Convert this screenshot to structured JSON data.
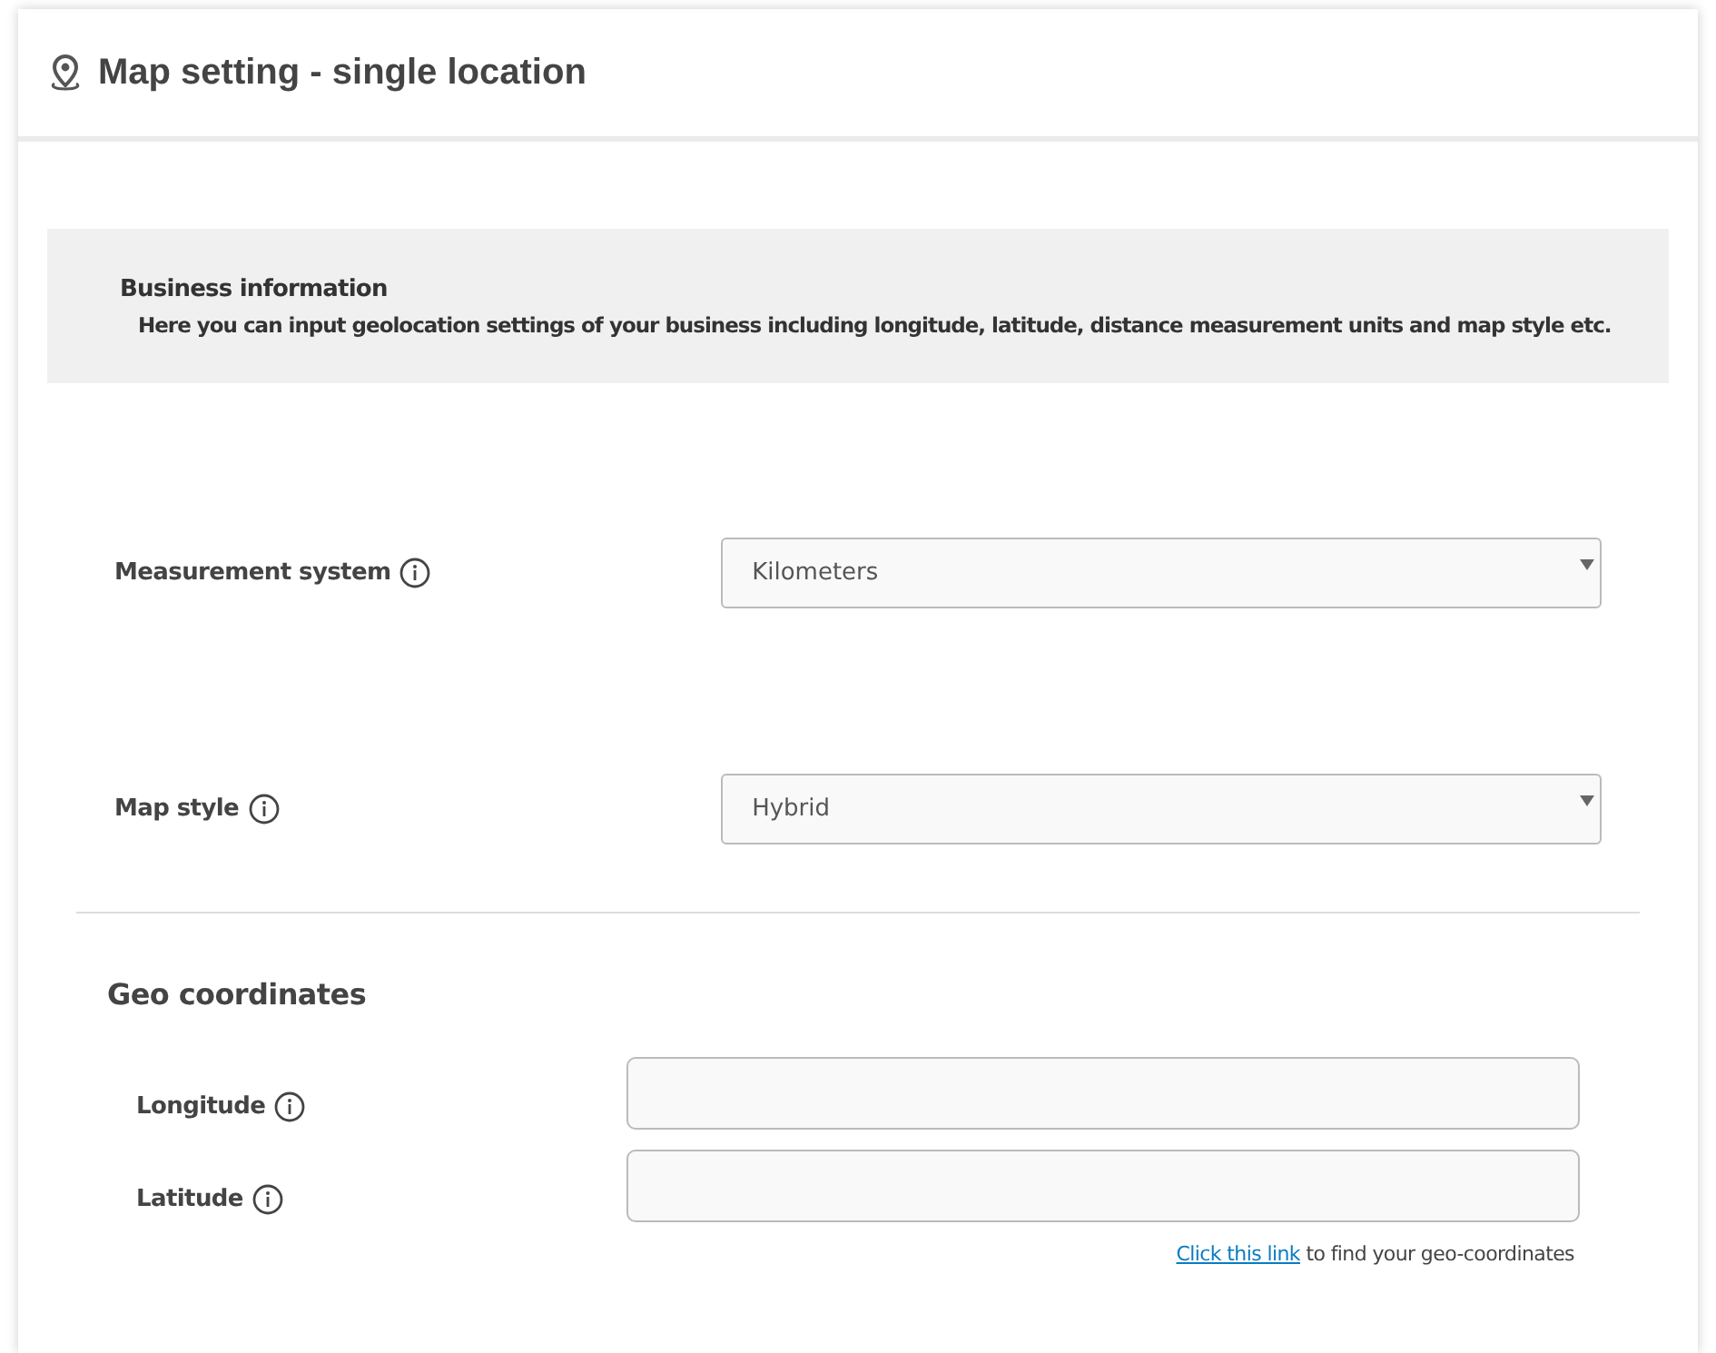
{
  "header": {
    "title": "Map setting - single location"
  },
  "info": {
    "title": "Business information",
    "text": "Here you can input geolocation settings of your business including longitude, latitude, distance measurement units and map style etc."
  },
  "settings": [
    {
      "label": "Measurement system",
      "value": "Kilometers"
    },
    {
      "label": "Map style",
      "value": "Hybrid"
    }
  ],
  "geo": {
    "title": "Geo coordinates",
    "fields": [
      {
        "label": "Longitude"
      },
      {
        "label": "Latitude"
      }
    ],
    "hint": {
      "link": "Click this link",
      "text": "to find your geo-coordinates"
    }
  }
}
